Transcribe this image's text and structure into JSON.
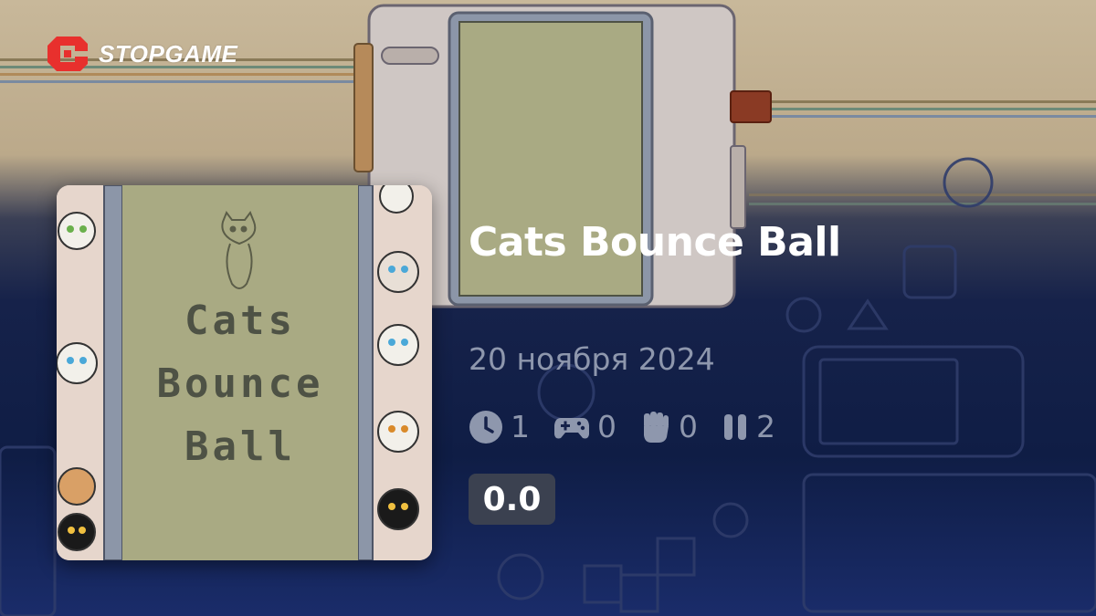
{
  "brand": {
    "logo_text": "STOPGAME",
    "logo_color": "#e8302d"
  },
  "game": {
    "title": "Cats Bounce Ball",
    "release_date": "20 ноября 2024",
    "cover_text_lines": [
      "Cats",
      "Bounce",
      "Ball"
    ]
  },
  "stats": [
    {
      "icon": "clock-icon",
      "value": "1"
    },
    {
      "icon": "gamepad-icon",
      "value": "0"
    },
    {
      "icon": "fist-icon",
      "value": "0"
    },
    {
      "icon": "pause-icon",
      "value": "2"
    }
  ],
  "rating": {
    "value": "0.0"
  },
  "colors": {
    "title": "#ffffff",
    "meta": "#8e97ad",
    "rating_bg": "#3b4150",
    "cover_panel": "#a9aa83"
  }
}
